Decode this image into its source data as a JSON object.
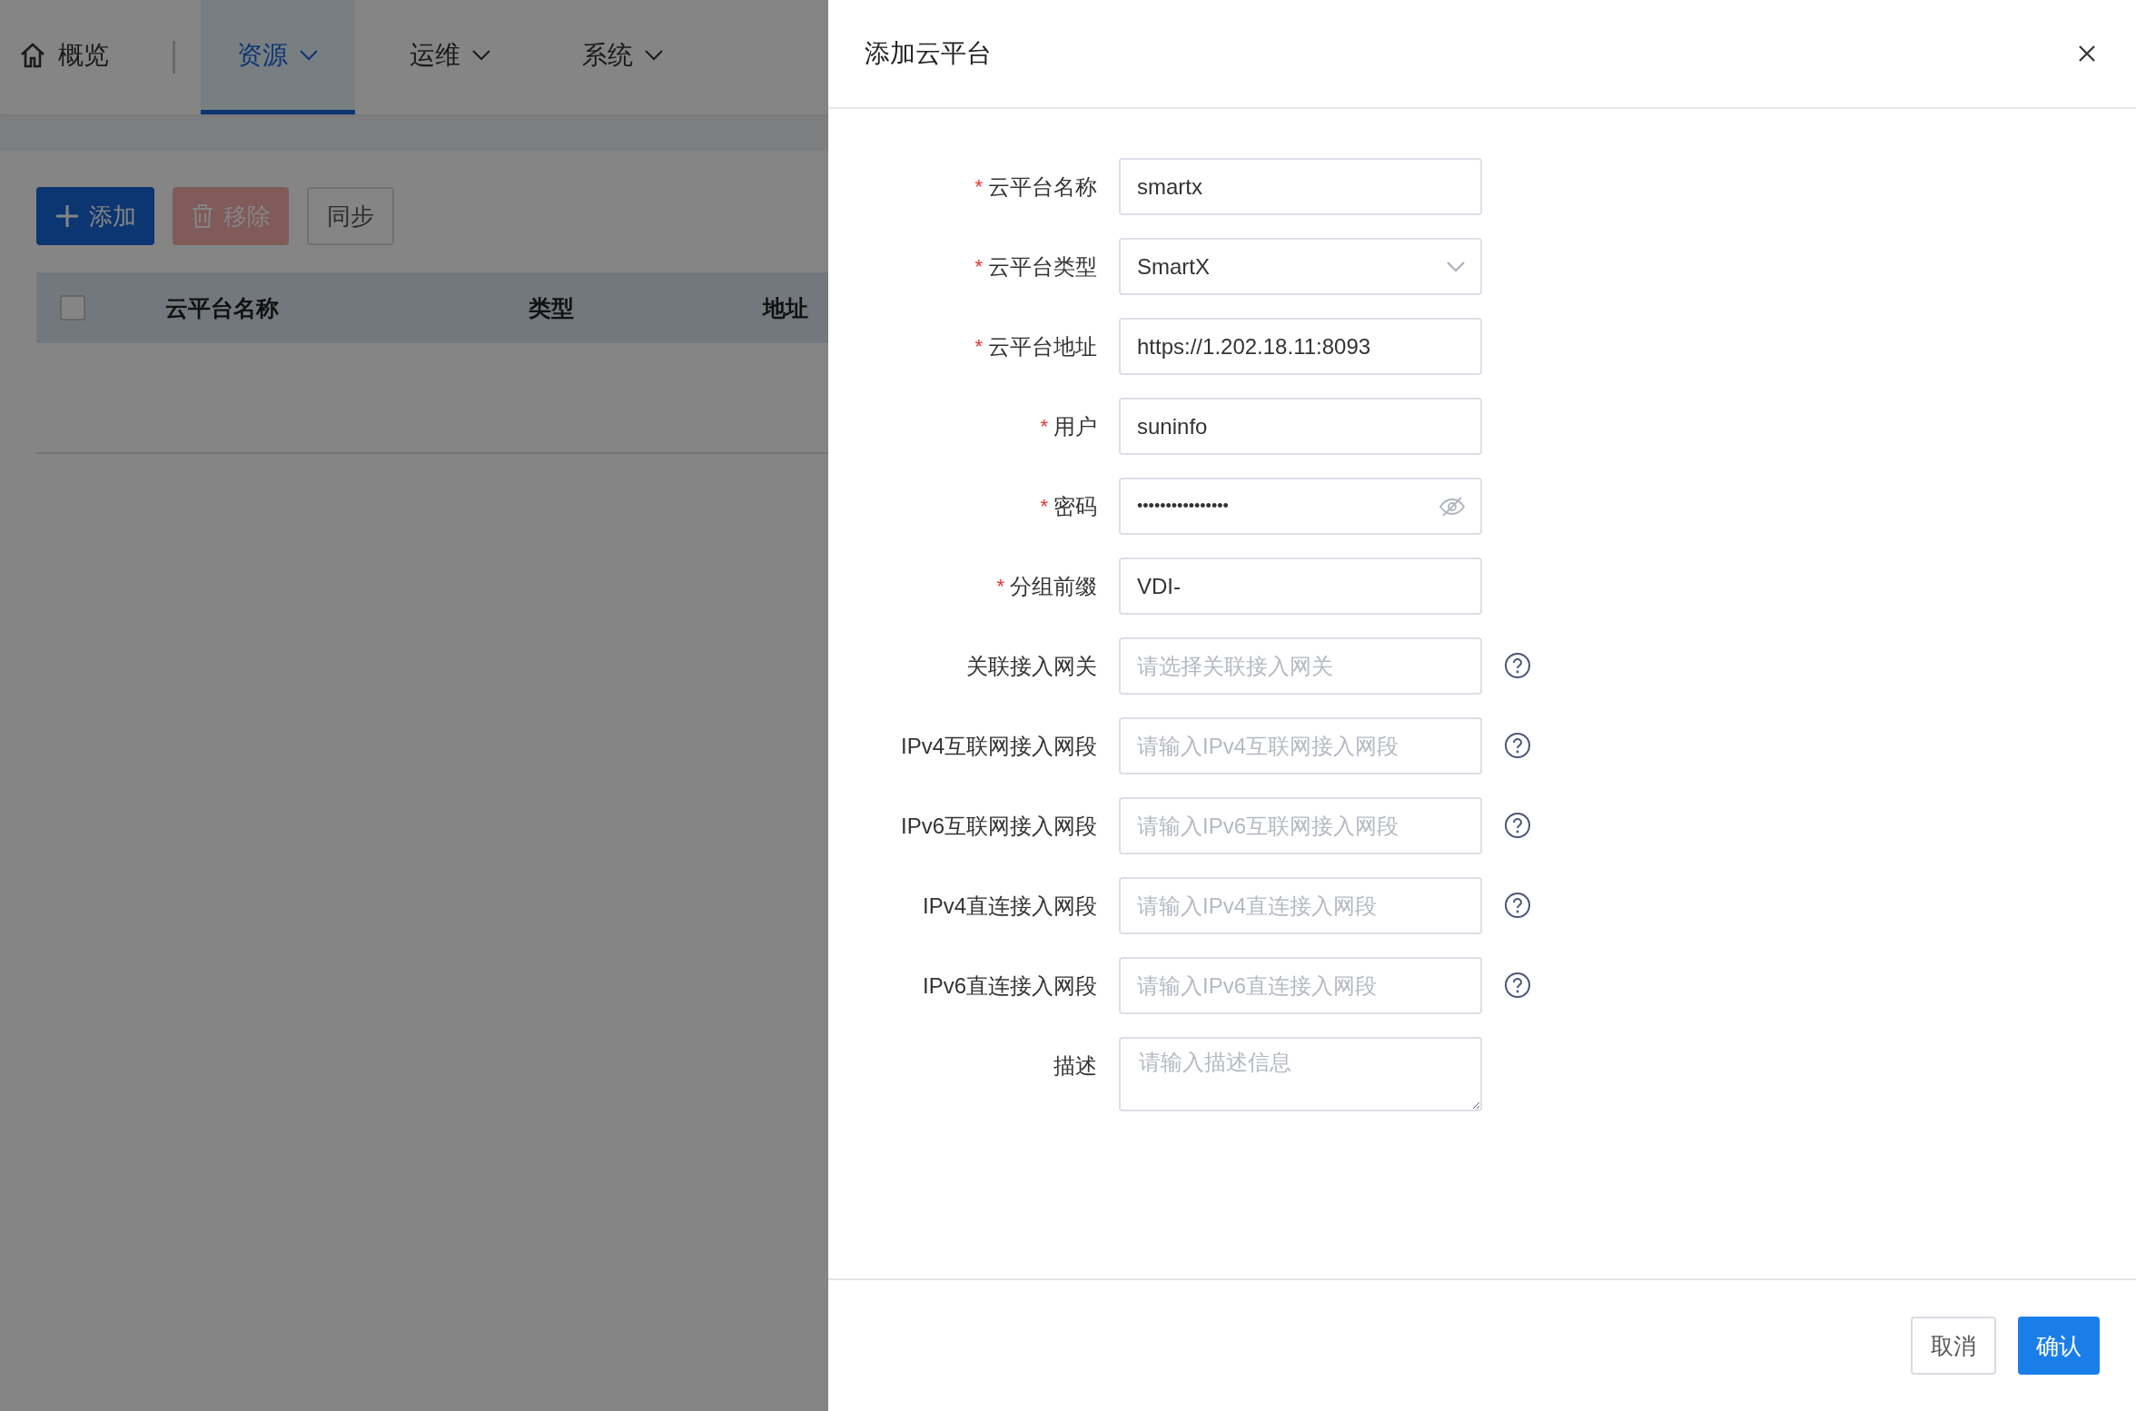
{
  "nav": {
    "items": [
      {
        "label": "概览",
        "kind": "home",
        "selected": false
      },
      {
        "label": "资源",
        "kind": "menu",
        "selected": true
      },
      {
        "label": "运维",
        "kind": "menu",
        "selected": false
      },
      {
        "label": "系统",
        "kind": "menu",
        "selected": false
      }
    ]
  },
  "toolbar": {
    "buttons": [
      {
        "label": "添加",
        "kind": "add",
        "disabled": false
      },
      {
        "label": "移除",
        "kind": "remove",
        "disabled": true
      },
      {
        "label": "同步",
        "kind": "plain",
        "disabled": false
      }
    ]
  },
  "table": {
    "select_all": {
      "checked": false
    },
    "columns": [
      "云平台名称",
      "类型",
      "地址"
    ]
  },
  "drawer": {
    "title": "添加云平台",
    "fields": [
      {
        "required_mark": "*",
        "label": "云平台名称",
        "kind": "text",
        "value": "smartx",
        "help": false
      },
      {
        "required_mark": "*",
        "label": "云平台类型",
        "kind": "select",
        "value": "SmartX",
        "help": false
      },
      {
        "required_mark": "*",
        "label": "云平台地址",
        "kind": "text",
        "value": "https://1.202.18.11:8093",
        "help": false
      },
      {
        "required_mark": "*",
        "label": "用户",
        "kind": "text",
        "value": "suninfo",
        "help": false
      },
      {
        "required_mark": "*",
        "label": "密码",
        "kind": "password",
        "value": "••••••••••••••••",
        "help": false
      },
      {
        "required_mark": "*",
        "label": "分组前缀",
        "kind": "text",
        "value": "VDI-",
        "help": false
      },
      {
        "label": "关联接入网关",
        "kind": "text",
        "placeholder": "请选择关联接入网关",
        "help": true
      },
      {
        "label": "IPv4互联网接入网段",
        "kind": "text",
        "placeholder": "请输入IPv4互联网接入网段",
        "help": true
      },
      {
        "label": "IPv6互联网接入网段",
        "kind": "text",
        "placeholder": "请输入IPv6互联网接入网段",
        "help": true
      },
      {
        "label": "IPv4直连接入网段",
        "kind": "text",
        "placeholder": "请输入IPv4直连接入网段",
        "help": true
      },
      {
        "label": "IPv6直连接入网段",
        "kind": "text",
        "placeholder": "请输入IPv6直连接入网段",
        "help": true
      },
      {
        "label": "描述",
        "kind": "textarea",
        "placeholder": "请输入描述信息",
        "help": false
      }
    ],
    "buttons": [
      {
        "label": "取消",
        "kind": "default"
      },
      {
        "label": "确认",
        "kind": "primary"
      }
    ]
  }
}
